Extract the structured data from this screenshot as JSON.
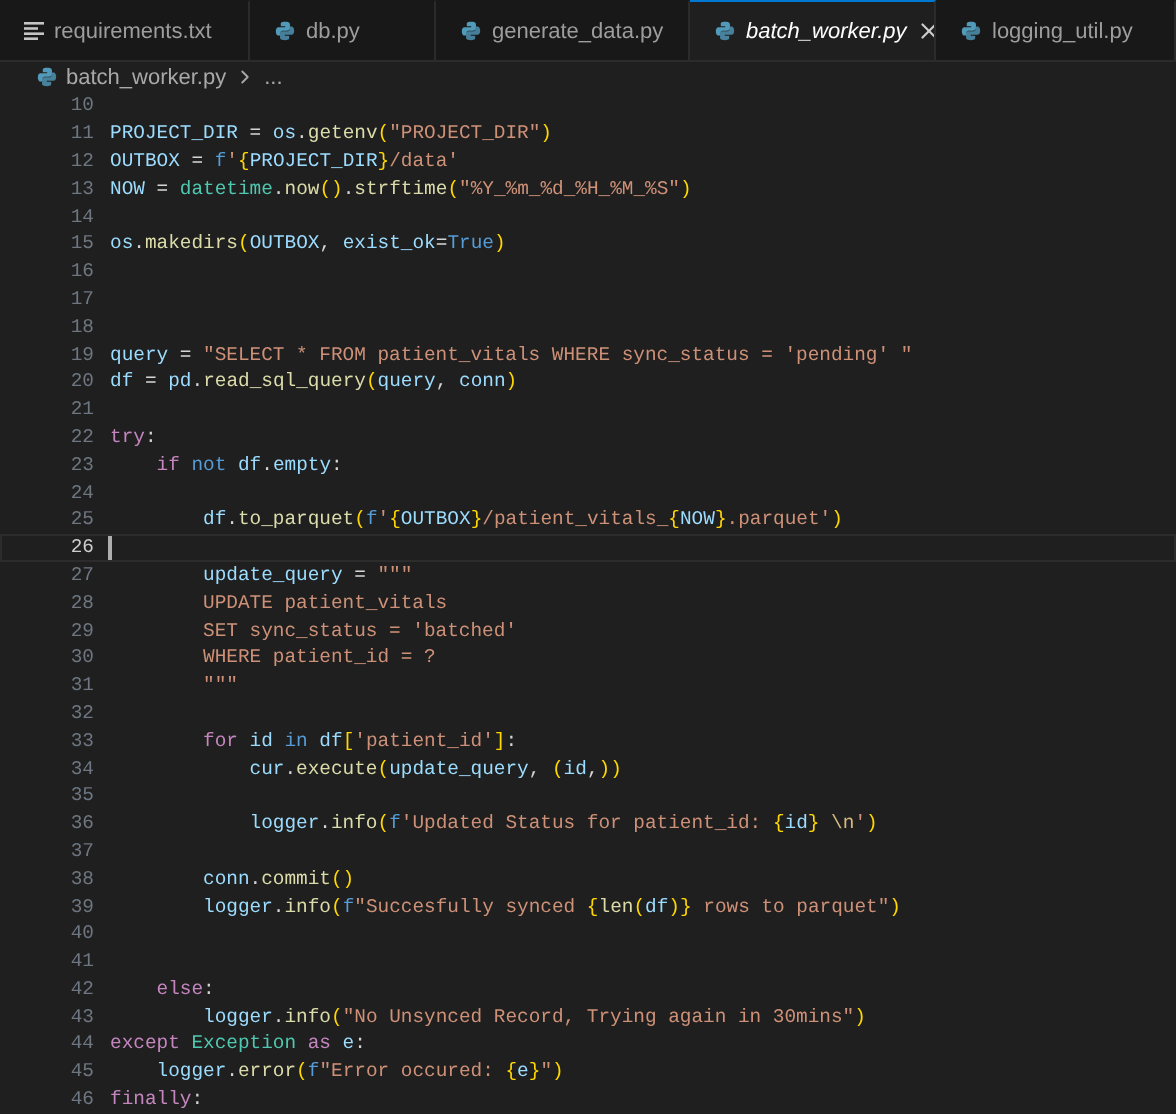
{
  "tabs": [
    {
      "label": "requirements.txt",
      "kind": "text",
      "selected": false
    },
    {
      "label": "db.py",
      "kind": "python",
      "selected": false
    },
    {
      "label": "generate_data.py",
      "kind": "python",
      "selected": false
    },
    {
      "label": "batch_worker.py",
      "kind": "python",
      "selected": true
    },
    {
      "label": "logging_util.py",
      "kind": "python",
      "selected": false
    }
  ],
  "breadcrumb": {
    "file": "batch_worker.py",
    "rest": "..."
  },
  "lines": [
    {
      "number": "10",
      "current": false
    },
    {
      "number": "11",
      "current": false,
      "tokens": [
        {
          "kind": "v",
          "text": "PROJECT_DIR"
        },
        {
          "kind": "p",
          "text": " = "
        },
        {
          "kind": "v",
          "text": "os"
        },
        {
          "kind": "p",
          "text": "."
        },
        {
          "kind": "f",
          "text": "getenv"
        },
        {
          "kind": "y",
          "text": "("
        },
        {
          "kind": "s",
          "text": "\"PROJECT_DIR\""
        },
        {
          "kind": "y",
          "text": ")"
        }
      ]
    },
    {
      "number": "12",
      "current": false,
      "tokens": [
        {
          "kind": "v",
          "text": "OUTBOX"
        },
        {
          "kind": "p",
          "text": " = "
        },
        {
          "kind": "b",
          "text": "f"
        },
        {
          "kind": "s",
          "text": "'"
        },
        {
          "kind": "y",
          "text": "{"
        },
        {
          "kind": "v",
          "text": "PROJECT_DIR"
        },
        {
          "kind": "y",
          "text": "}"
        },
        {
          "kind": "s",
          "text": "/data'"
        }
      ]
    },
    {
      "number": "13",
      "current": false,
      "tokens": [
        {
          "kind": "v",
          "text": "NOW"
        },
        {
          "kind": "p",
          "text": " = "
        },
        {
          "kind": "c",
          "text": "datetime"
        },
        {
          "kind": "p",
          "text": "."
        },
        {
          "kind": "f",
          "text": "now"
        },
        {
          "kind": "y",
          "text": "()"
        },
        {
          "kind": "p",
          "text": "."
        },
        {
          "kind": "f",
          "text": "strftime"
        },
        {
          "kind": "y",
          "text": "("
        },
        {
          "kind": "s",
          "text": "\"%Y_%m_%d_%H_%M_%S\""
        },
        {
          "kind": "y",
          "text": ")"
        }
      ]
    },
    {
      "number": "14",
      "current": false
    },
    {
      "number": "15",
      "current": false,
      "tokens": [
        {
          "kind": "v",
          "text": "os"
        },
        {
          "kind": "p",
          "text": "."
        },
        {
          "kind": "f",
          "text": "makedirs"
        },
        {
          "kind": "y",
          "text": "("
        },
        {
          "kind": "v",
          "text": "OUTBOX"
        },
        {
          "kind": "p",
          "text": ", "
        },
        {
          "kind": "v",
          "text": "exist_ok"
        },
        {
          "kind": "p",
          "text": "="
        },
        {
          "kind": "b",
          "text": "True"
        },
        {
          "kind": "y",
          "text": ")"
        }
      ]
    },
    {
      "number": "16",
      "current": false
    },
    {
      "number": "17",
      "current": false
    },
    {
      "number": "18",
      "current": false
    },
    {
      "number": "19",
      "current": false,
      "tokens": [
        {
          "kind": "v",
          "text": "query"
        },
        {
          "kind": "p",
          "text": " = "
        },
        {
          "kind": "s",
          "text": "\"SELECT * FROM patient_vitals WHERE sync_status = 'pending' \""
        }
      ]
    },
    {
      "number": "20",
      "current": false,
      "tokens": [
        {
          "kind": "v",
          "text": "df"
        },
        {
          "kind": "p",
          "text": " = "
        },
        {
          "kind": "v",
          "text": "pd"
        },
        {
          "kind": "p",
          "text": "."
        },
        {
          "kind": "f",
          "text": "read_sql_query"
        },
        {
          "kind": "y",
          "text": "("
        },
        {
          "kind": "v",
          "text": "query"
        },
        {
          "kind": "p",
          "text": ", "
        },
        {
          "kind": "v",
          "text": "conn"
        },
        {
          "kind": "y",
          "text": ")"
        }
      ]
    },
    {
      "number": "21",
      "current": false
    },
    {
      "number": "22",
      "current": false,
      "tokens": [
        {
          "kind": "k",
          "text": "try"
        },
        {
          "kind": "p",
          "text": ":"
        }
      ]
    },
    {
      "number": "23",
      "current": false,
      "tokens": [
        {
          "kind": "k",
          "text": "    if"
        },
        {
          "kind": "b",
          "text": " not"
        },
        {
          "kind": "v",
          "text": " df"
        },
        {
          "kind": "p",
          "text": "."
        },
        {
          "kind": "v",
          "text": "empty"
        },
        {
          "kind": "p",
          "text": ":"
        }
      ]
    },
    {
      "number": "24",
      "current": false
    },
    {
      "number": "25",
      "current": false,
      "tokens": [
        {
          "kind": "v",
          "text": "        df"
        },
        {
          "kind": "p",
          "text": "."
        },
        {
          "kind": "f",
          "text": "to_parquet"
        },
        {
          "kind": "y",
          "text": "("
        },
        {
          "kind": "b",
          "text": "f"
        },
        {
          "kind": "s",
          "text": "'"
        },
        {
          "kind": "y",
          "text": "{"
        },
        {
          "kind": "v",
          "text": "OUTBOX"
        },
        {
          "kind": "y",
          "text": "}"
        },
        {
          "kind": "s",
          "text": "/patient_vitals_"
        },
        {
          "kind": "y",
          "text": "{"
        },
        {
          "kind": "v",
          "text": "NOW"
        },
        {
          "kind": "y",
          "text": "}"
        },
        {
          "kind": "s",
          "text": ".parquet'"
        },
        {
          "kind": "y",
          "text": ")"
        }
      ]
    },
    {
      "number": "26",
      "current": true
    },
    {
      "number": "27",
      "current": false,
      "tokens": [
        {
          "kind": "v",
          "text": "        update_query"
        },
        {
          "kind": "p",
          "text": " = "
        },
        {
          "kind": "s",
          "text": "\"\"\""
        }
      ]
    },
    {
      "number": "28",
      "current": false,
      "tokens": [
        {
          "kind": "s",
          "text": "        UPDATE patient_vitals"
        }
      ]
    },
    {
      "number": "29",
      "current": false,
      "tokens": [
        {
          "kind": "s",
          "text": "        SET sync_status = 'batched'"
        }
      ]
    },
    {
      "number": "30",
      "current": false,
      "tokens": [
        {
          "kind": "s",
          "text": "        WHERE patient_id = ?"
        }
      ]
    },
    {
      "number": "31",
      "current": false,
      "tokens": [
        {
          "kind": "s",
          "text": "        \"\"\""
        }
      ]
    },
    {
      "number": "32",
      "current": false
    },
    {
      "number": "33",
      "current": false,
      "tokens": [
        {
          "kind": "k",
          "text": "        for"
        },
        {
          "kind": "v",
          "text": " id"
        },
        {
          "kind": "b",
          "text": " in"
        },
        {
          "kind": "v",
          "text": " df"
        },
        {
          "kind": "y",
          "text": "["
        },
        {
          "kind": "s",
          "text": "'patient_id'"
        },
        {
          "kind": "y",
          "text": "]"
        },
        {
          "kind": "p",
          "text": ":"
        }
      ]
    },
    {
      "number": "34",
      "current": false,
      "tokens": [
        {
          "kind": "v",
          "text": "            cur"
        },
        {
          "kind": "p",
          "text": "."
        },
        {
          "kind": "f",
          "text": "execute"
        },
        {
          "kind": "y",
          "text": "("
        },
        {
          "kind": "v",
          "text": "update_query"
        },
        {
          "kind": "p",
          "text": ", "
        },
        {
          "kind": "y",
          "text": "("
        },
        {
          "kind": "v",
          "text": "id"
        },
        {
          "kind": "p",
          "text": ","
        },
        {
          "kind": "y",
          "text": "))"
        }
      ]
    },
    {
      "number": "35",
      "current": false
    },
    {
      "number": "36",
      "current": false,
      "tokens": [
        {
          "kind": "v",
          "text": "            logger"
        },
        {
          "kind": "p",
          "text": "."
        },
        {
          "kind": "f",
          "text": "info"
        },
        {
          "kind": "y",
          "text": "("
        },
        {
          "kind": "b",
          "text": "f"
        },
        {
          "kind": "s",
          "text": "'Updated Status for patient_id: "
        },
        {
          "kind": "y",
          "text": "{"
        },
        {
          "kind": "v",
          "text": "id"
        },
        {
          "kind": "y",
          "text": "}"
        },
        {
          "kind": "e",
          "text": " \\n"
        },
        {
          "kind": "s",
          "text": "'"
        },
        {
          "kind": "y",
          "text": ")"
        }
      ]
    },
    {
      "number": "37",
      "current": false
    },
    {
      "number": "38",
      "current": false,
      "tokens": [
        {
          "kind": "v",
          "text": "        conn"
        },
        {
          "kind": "p",
          "text": "."
        },
        {
          "kind": "f",
          "text": "commit"
        },
        {
          "kind": "y",
          "text": "()"
        }
      ]
    },
    {
      "number": "39",
      "current": false,
      "tokens": [
        {
          "kind": "v",
          "text": "        logger"
        },
        {
          "kind": "p",
          "text": "."
        },
        {
          "kind": "f",
          "text": "info"
        },
        {
          "kind": "y",
          "text": "("
        },
        {
          "kind": "b",
          "text": "f"
        },
        {
          "kind": "s",
          "text": "\"Succesfully synced "
        },
        {
          "kind": "y",
          "text": "{"
        },
        {
          "kind": "f",
          "text": "len"
        },
        {
          "kind": "y",
          "text": "("
        },
        {
          "kind": "v",
          "text": "df"
        },
        {
          "kind": "y",
          "text": ")}"
        },
        {
          "kind": "s",
          "text": " rows to parquet\""
        },
        {
          "kind": "y",
          "text": ")"
        }
      ]
    },
    {
      "number": "40",
      "current": false
    },
    {
      "number": "41",
      "current": false
    },
    {
      "number": "42",
      "current": false,
      "tokens": [
        {
          "kind": "k",
          "text": "    else"
        },
        {
          "kind": "p",
          "text": ":"
        }
      ]
    },
    {
      "number": "43",
      "current": false,
      "tokens": [
        {
          "kind": "v",
          "text": "        logger"
        },
        {
          "kind": "p",
          "text": "."
        },
        {
          "kind": "f",
          "text": "info"
        },
        {
          "kind": "y",
          "text": "("
        },
        {
          "kind": "s",
          "text": "\"No Unsynced Record, Trying again in 30mins\""
        },
        {
          "kind": "y",
          "text": ")"
        }
      ]
    },
    {
      "number": "44",
      "current": false,
      "tokens": [
        {
          "kind": "k",
          "text": "except"
        },
        {
          "kind": "c",
          "text": " Exception"
        },
        {
          "kind": "k",
          "text": " as"
        },
        {
          "kind": "v",
          "text": " e"
        },
        {
          "kind": "p",
          "text": ":"
        }
      ]
    },
    {
      "number": "45",
      "current": false,
      "tokens": [
        {
          "kind": "v",
          "text": "    logger"
        },
        {
          "kind": "p",
          "text": "."
        },
        {
          "kind": "f",
          "text": "error"
        },
        {
          "kind": "y",
          "text": "("
        },
        {
          "kind": "b",
          "text": "f"
        },
        {
          "kind": "s",
          "text": "\"Error occured: "
        },
        {
          "kind": "y",
          "text": "{"
        },
        {
          "kind": "v",
          "text": "e"
        },
        {
          "kind": "y",
          "text": "}"
        },
        {
          "kind": "s",
          "text": "\""
        },
        {
          "kind": "y",
          "text": ")"
        }
      ]
    },
    {
      "number": "46",
      "current": false,
      "tokens": [
        {
          "kind": "k",
          "text": "finally"
        },
        {
          "kind": "p",
          "text": ":"
        }
      ]
    }
  ]
}
